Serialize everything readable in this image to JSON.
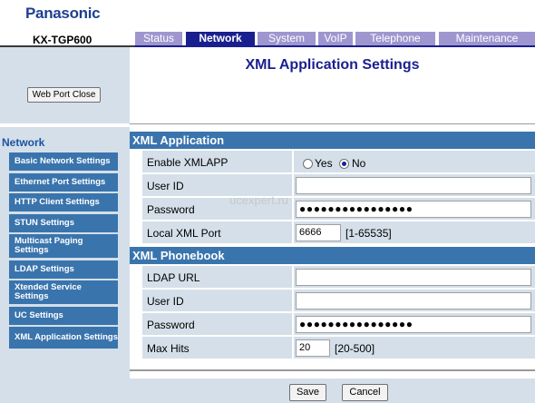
{
  "header": {
    "brand": "Panasonic",
    "model": "KX-TGP600",
    "tabs": [
      {
        "label": "Status",
        "active": false
      },
      {
        "label": "Network",
        "active": true
      },
      {
        "label": "System",
        "active": false
      },
      {
        "label": "VoIP",
        "active": false
      },
      {
        "label": "Telephone",
        "active": false
      },
      {
        "label": "Maintenance",
        "active": false
      }
    ]
  },
  "sidebar": {
    "web_port_button": "Web Port Close",
    "heading": "Network",
    "items": [
      {
        "label": "Basic Network Settings"
      },
      {
        "label": "Ethernet Port Settings"
      },
      {
        "label": "HTTP Client Settings"
      },
      {
        "label": "STUN Settings"
      },
      {
        "label": "Multicast Paging Settings"
      },
      {
        "label": "LDAP Settings"
      },
      {
        "label": "Xtended Service Settings"
      },
      {
        "label": "UC Settings"
      },
      {
        "label": "XML Application Settings",
        "selected": true
      }
    ]
  },
  "main": {
    "title": "XML Application Settings",
    "xml_application": {
      "heading": "XML Application",
      "enable_label": "Enable XMLAPP",
      "enable_options": {
        "yes": "Yes",
        "no": "No",
        "selected": "No"
      },
      "user_id_label": "User ID",
      "user_id_value": "",
      "password_label": "Password",
      "password_value": "●●●●●●●●●●●●●●●●",
      "local_port_label": "Local XML Port",
      "local_port_value": "6666",
      "local_port_range": "[1-65535]"
    },
    "xml_phonebook": {
      "heading": "XML Phonebook",
      "ldap_url_label": "LDAP URL",
      "ldap_url_value": "",
      "user_id_label": "User ID",
      "user_id_value": "",
      "password_label": "Password",
      "password_value": "●●●●●●●●●●●●●●●●",
      "max_hits_label": "Max Hits",
      "max_hits_value": "20",
      "max_hits_range": "[20-500]"
    }
  },
  "footer": {
    "save_label": "Save",
    "cancel_label": "Cancel"
  },
  "watermark": "ucexpert.ru",
  "colors": {
    "brand": "#1f3f8f",
    "tab_active": "#1a1f8f",
    "tab_inactive": "#9f96cf",
    "section_header": "#3a74ad",
    "row_background": "#d4dfe9"
  }
}
